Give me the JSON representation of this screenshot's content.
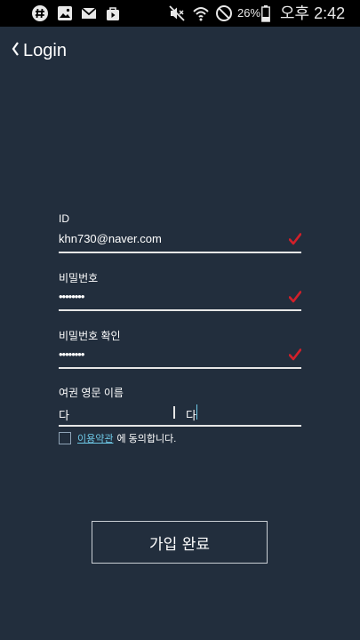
{
  "status_bar": {
    "notification_icons": [
      "slack-icon",
      "gallery-icon",
      "gmail-icon",
      "bag-icon"
    ],
    "battery_percent": "26%",
    "time": "오후 2:42"
  },
  "header": {
    "title": "Login"
  },
  "form": {
    "id": {
      "label": "ID",
      "value": "khn730@naver.com",
      "valid": true
    },
    "password": {
      "label": "비밀번호",
      "value": "••••••••",
      "valid": true
    },
    "password_confirm": {
      "label": "비밀번호 확인",
      "value": "••••••••",
      "valid": true
    },
    "passport_name": {
      "label": "여권 영문 이름",
      "first_value": "다",
      "second_value": "다"
    },
    "agreement": {
      "checked": false,
      "link_text": "이용약관",
      "text": "에 동의합니다."
    }
  },
  "submit_label": "가입 완료",
  "colors": {
    "background": "#222e3d",
    "status_bar": "#000000",
    "check": "#d2202a",
    "link": "#6ec8e6",
    "underline": "#e6e6e6"
  }
}
